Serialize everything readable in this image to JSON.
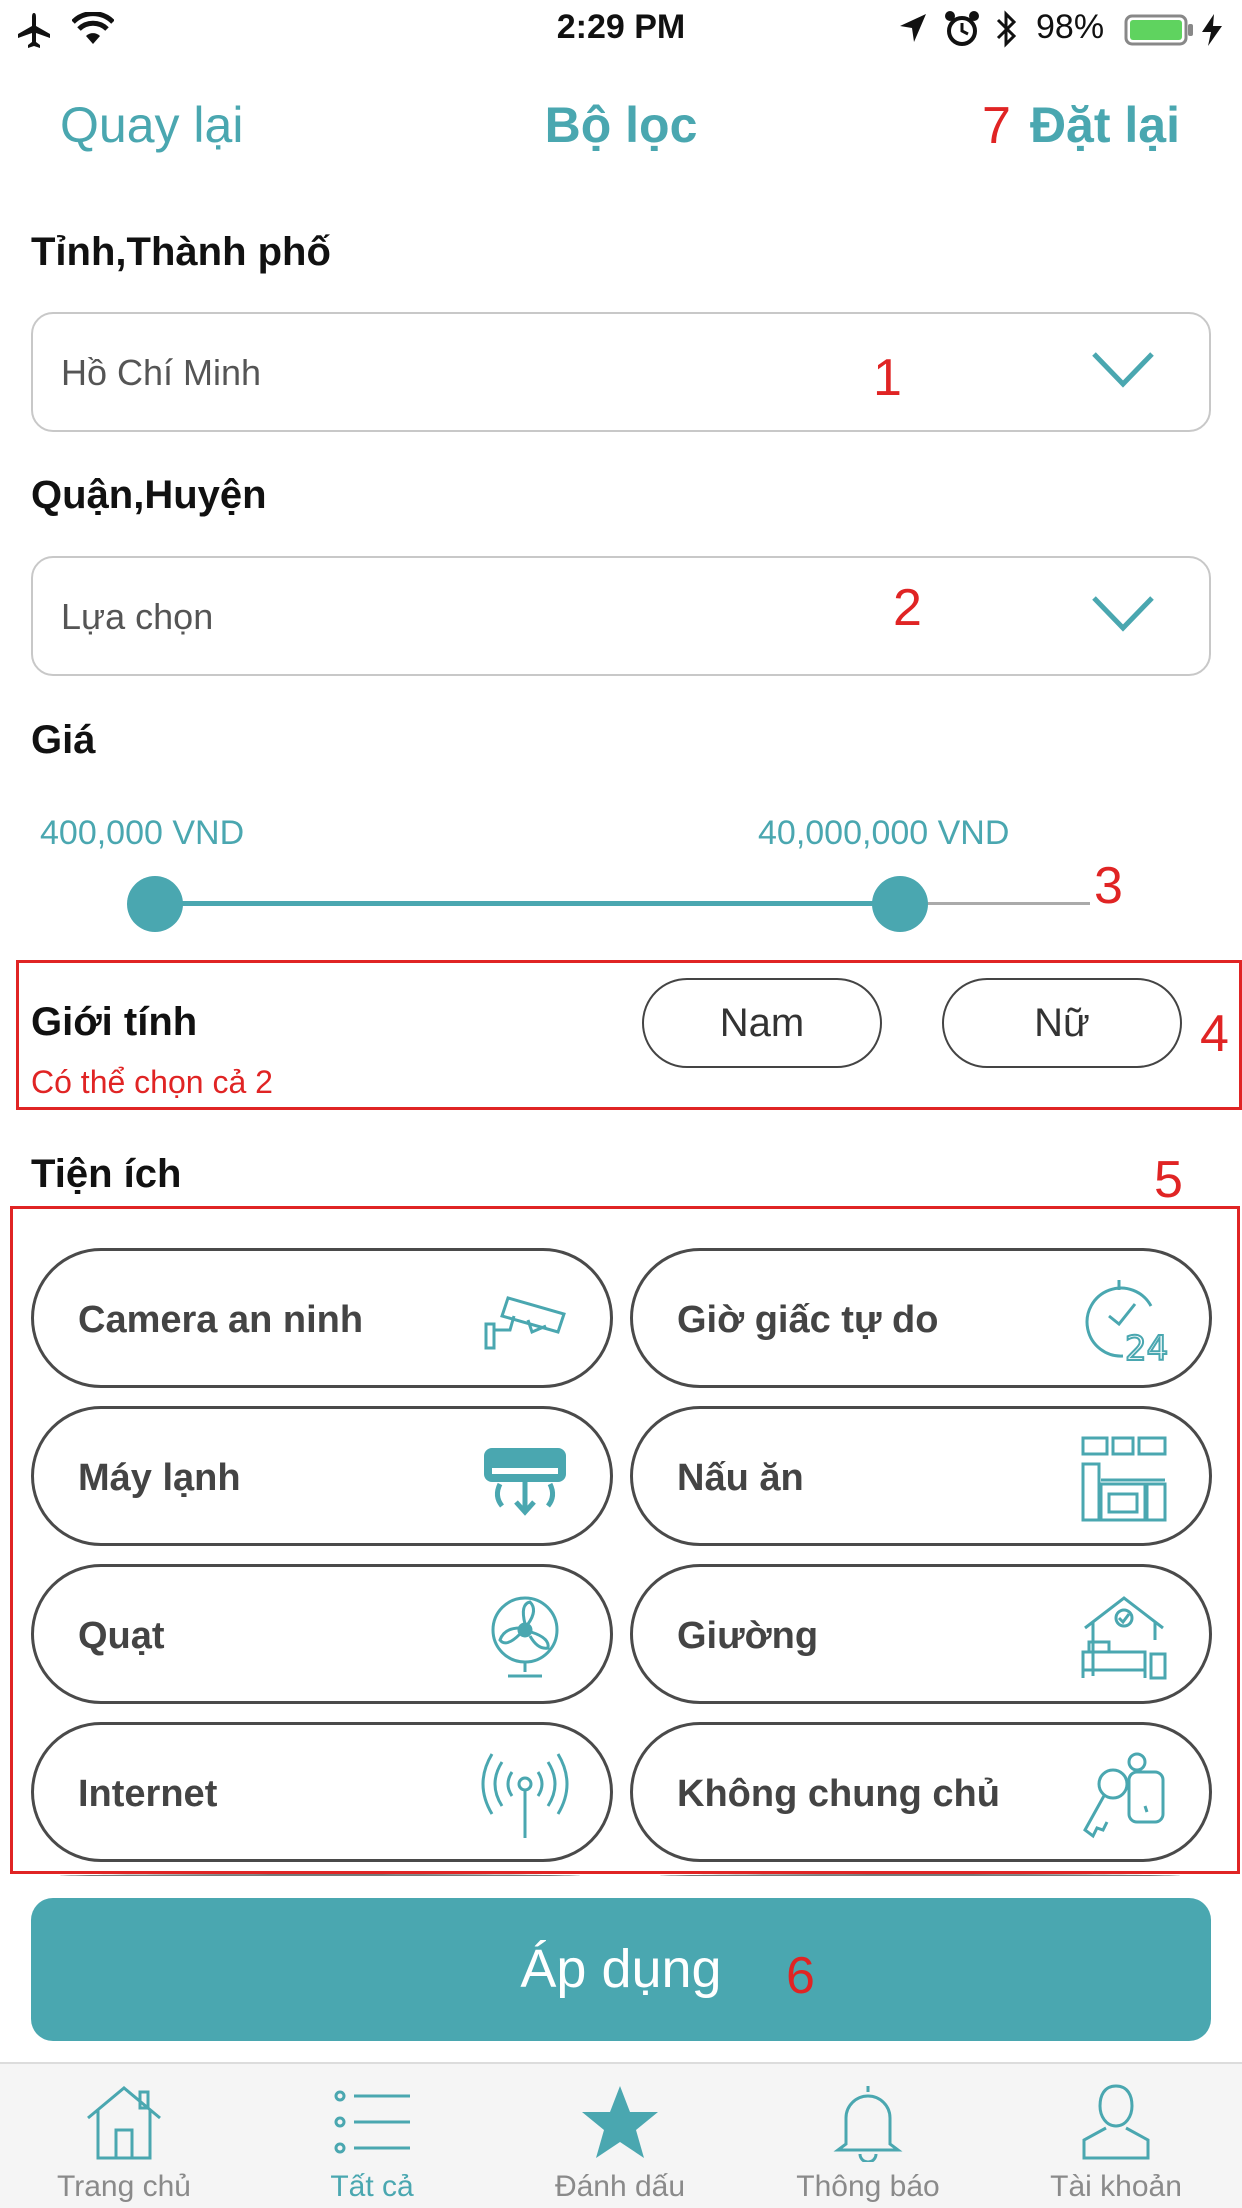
{
  "status_bar": {
    "time": "2:29 PM",
    "battery": "98%",
    "icons": [
      "airplane-icon",
      "wifi-icon",
      "location-icon",
      "alarm-icon",
      "bluetooth-icon",
      "battery-icon",
      "charging-icon"
    ]
  },
  "header": {
    "back": "Quay lại",
    "title": "Bộ lọc",
    "reset": "Đặt lại"
  },
  "annotations": {
    "a1": "1",
    "a2": "2",
    "a3": "3",
    "a4": "4",
    "a5": "5",
    "a6": "6",
    "a7": "7",
    "color": "#e02424"
  },
  "city": {
    "label": "Tỉnh,Thành phố",
    "value": "Hồ Chí Minh"
  },
  "district": {
    "label": "Quận,Huyện",
    "value": "Lựa chọn"
  },
  "price": {
    "label": "Giá",
    "min": "400,000 VND",
    "max": "40,000,000 VND"
  },
  "gender": {
    "label": "Giới tính",
    "hint": "Có thể chọn cả 2",
    "options": [
      "Nam",
      "Nữ"
    ]
  },
  "amenities": {
    "label": "Tiện ích",
    "items": [
      {
        "label": "Camera an ninh",
        "icon": "security-camera-icon"
      },
      {
        "label": "Giờ giấc tự do",
        "icon": "clock-24-icon"
      },
      {
        "label": "Máy lạnh",
        "icon": "air-conditioner-icon"
      },
      {
        "label": "Nấu ăn",
        "icon": "kitchen-icon"
      },
      {
        "label": "Quạt",
        "icon": "fan-icon"
      },
      {
        "label": "Giường",
        "icon": "bed-icon"
      },
      {
        "label": "Internet",
        "icon": "antenna-icon"
      },
      {
        "label": "Không chung chủ",
        "icon": "keys-icon"
      }
    ]
  },
  "apply": "Áp dụng",
  "tabs": [
    {
      "label": "Trang chủ",
      "icon": "home-icon"
    },
    {
      "label": "Tất cả",
      "icon": "list-icon",
      "active": true
    },
    {
      "label": "Đánh dấu",
      "icon": "star-icon"
    },
    {
      "label": "Thông báo",
      "icon": "bell-icon"
    },
    {
      "label": "Tài khoản",
      "icon": "user-icon"
    }
  ],
  "colors": {
    "accent": "#4aa7b0",
    "annotation": "#e02424"
  }
}
